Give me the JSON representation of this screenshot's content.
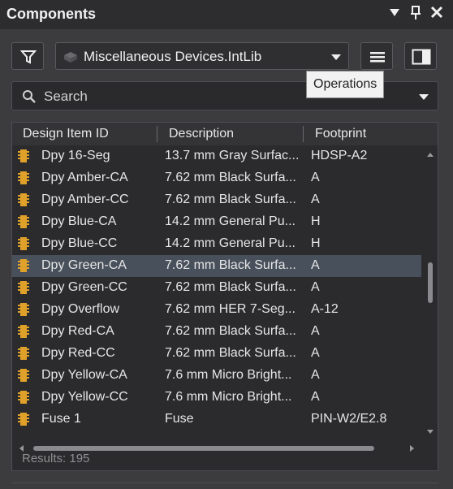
{
  "panel": {
    "title": "Components",
    "library": "Miscellaneous Devices.IntLib",
    "search_placeholder": "Search",
    "tooltip": "Operations",
    "results": "Results: 195"
  },
  "columns": [
    "Design Item ID",
    "Description",
    "Footprint"
  ],
  "rows": [
    {
      "id": "Dpy 16-Seg",
      "desc": "13.7 mm Gray Surfac...",
      "fp": "HDSP-A2"
    },
    {
      "id": "Dpy Amber-CA",
      "desc": "7.62 mm Black Surfa...",
      "fp": "A"
    },
    {
      "id": "Dpy Amber-CC",
      "desc": "7.62 mm Black Surfa...",
      "fp": "A"
    },
    {
      "id": "Dpy Blue-CA",
      "desc": "14.2 mm General Pu...",
      "fp": "H"
    },
    {
      "id": "Dpy Blue-CC",
      "desc": "14.2 mm General Pu...",
      "fp": "H"
    },
    {
      "id": "Dpy Green-CA",
      "desc": "7.62 mm Black Surfa...",
      "fp": "A"
    },
    {
      "id": "Dpy Green-CC",
      "desc": "7.62 mm Black Surfa...",
      "fp": "A"
    },
    {
      "id": "Dpy Overflow",
      "desc": "7.62 mm HER 7-Seg...",
      "fp": "A-12"
    },
    {
      "id": "Dpy Red-CA",
      "desc": "7.62 mm Black Surfa...",
      "fp": "A"
    },
    {
      "id": "Dpy Red-CC",
      "desc": "7.62 mm Black Surfa...",
      "fp": "A"
    },
    {
      "id": "Dpy Yellow-CA",
      "desc": "7.6 mm Micro Bright...",
      "fp": "A"
    },
    {
      "id": "Dpy Yellow-CC",
      "desc": "7.6 mm Micro Bright...",
      "fp": "A"
    },
    {
      "id": "Fuse 1",
      "desc": "Fuse",
      "fp": "PIN-W2/E2.8"
    }
  ],
  "selected_index": 5,
  "colors": {
    "accent_icon": "#e0a12b",
    "selected_row": "#48505b"
  }
}
